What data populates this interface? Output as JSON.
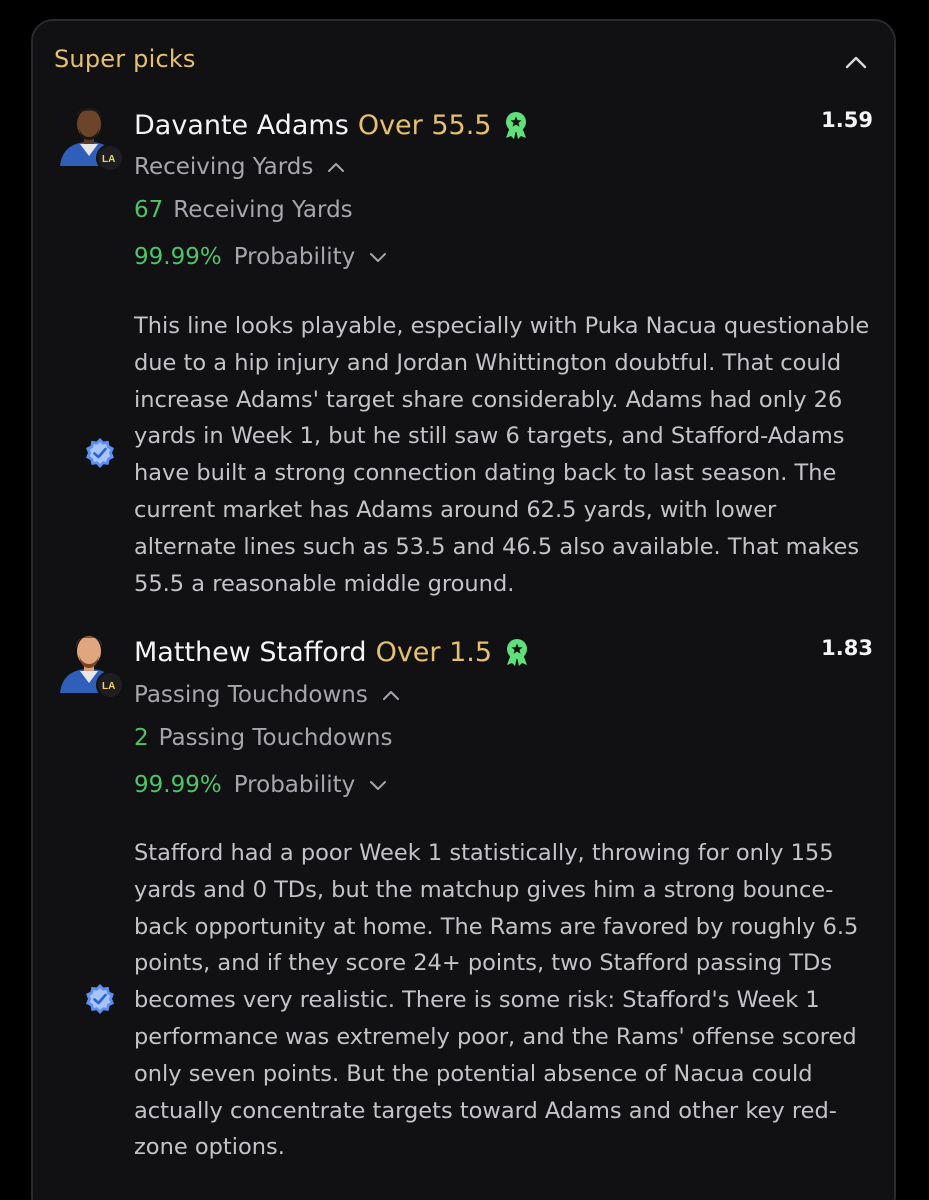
{
  "section": {
    "title": "Super picks"
  },
  "picks": [
    {
      "player": "Davante Adams",
      "line": "Over 55.5",
      "odds": "1.59",
      "market": "Receiving Yards",
      "result_value": "67",
      "result_label": "Receiving Yards",
      "probability": "99.99%",
      "probability_label": "Probability",
      "analysis": "This line looks playable, especially with Puka Nacua questionable due to a hip injury and Jordan Whittington doubtful. That could increase Adams' target share considerably. Adams had only 26 yards in Week 1, but he still saw 6 targets, and Stafford-Adams have built a strong connection dating back to last season.  The current market has Adams around 62.5 yards, with lower alternate lines such as 53.5 and 46.5 also available. That makes 55.5 a reasonable middle ground.",
      "team_badge_text": "LA"
    },
    {
      "player": "Matthew Stafford",
      "line": "Over 1.5",
      "odds": "1.83",
      "market": "Passing Touchdowns",
      "result_value": "2",
      "result_label": "Passing Touchdowns",
      "probability": "99.99%",
      "probability_label": "Probability",
      "analysis": "Stafford had a poor Week 1 statistically, throwing for only 155 yards and 0 TDs, but the matchup gives him a strong bounce-back opportunity at home. The Rams are favored by roughly 6.5 points, and if they score 24+ points, two Stafford passing TDs becomes very realistic.  There is some risk: Stafford's Week 1 performance was extremely poor, and the Rams' offense scored only seven points. But the potential absence of Nacua could actually concentrate targets toward Adams and other key red-zone options.",
      "team_badge_text": "LA"
    }
  ],
  "icons": {
    "collapse": "chevron-up-icon",
    "award": "award-ribbon-icon",
    "verified": "verified-badge-icon",
    "expand": "chevron-down-icon"
  },
  "colors": {
    "accent_gold": "#e6c06a",
    "positive_green": "#4ec36a",
    "award_green": "#5fe07a",
    "verified_blue": "#5b8ff5",
    "card_bg": "#111114"
  }
}
